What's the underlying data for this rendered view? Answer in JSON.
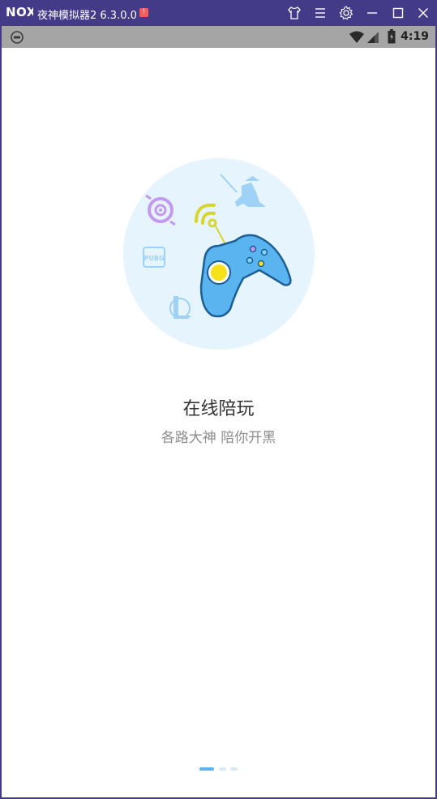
{
  "window": {
    "logo_text": "NOX",
    "title": "夜神模拟器2 6.3.0.0",
    "badge_text": "!",
    "buttons": [
      "shirt-icon",
      "menu-icon",
      "gear-icon",
      "minimize-icon",
      "maximize-icon",
      "close-icon"
    ]
  },
  "statusbar": {
    "time": "4:19",
    "icons": [
      "wifi-icon",
      "signal-icon",
      "battery-icon"
    ]
  },
  "onboarding": {
    "title": "在线陪玩",
    "subtitle": "各路大神 陪你开黑",
    "illustration_labels": {
      "pubg": "PUBG"
    },
    "page_count": 3,
    "current_page": 1
  },
  "colors": {
    "titlebar": "#433b88",
    "statusbar": "#a5a5a5",
    "illustration_bg": "#e6f4fd",
    "gamepad": "#5ab4f0",
    "accent_yellow": "#f7e11a",
    "dot_active": "#5ab4f0",
    "dot_inactive": "#d6ecfb"
  }
}
